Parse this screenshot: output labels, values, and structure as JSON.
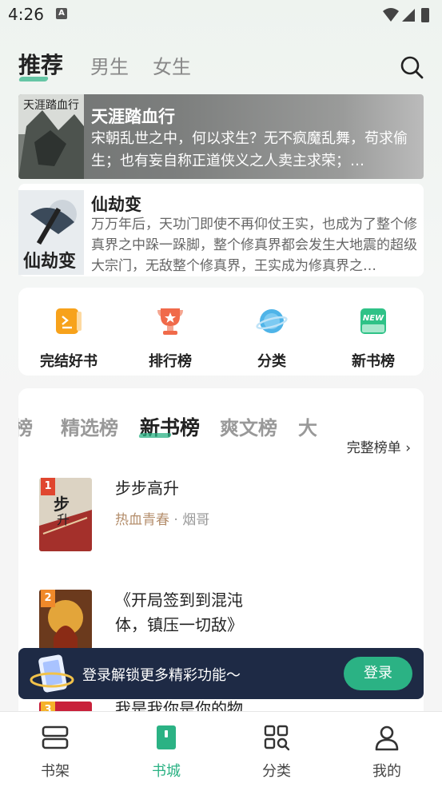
{
  "status_bar": {
    "time": "4:26",
    "notification_icon": "A"
  },
  "top_nav": {
    "tabs": [
      "推荐",
      "男生",
      "女生"
    ],
    "search_icon": "search-icon"
  },
  "featured_books": [
    {
      "title": "天涯踏血行",
      "description": "宋朝乱世之中，何以求生？无不疯魔乱舞，苟求偷生；也有妄自称正道侠义之人卖主求荣；…"
    },
    {
      "title": "仙劫变",
      "description": "万万年后，天功门即使不再仰仗王实，也成为了整个修真界之中跺一跺脚，整个修真界都会发生大地震的超级大宗门，无敌整个修真界，王实成为修真界之…"
    }
  ],
  "quick_entries": [
    {
      "label": "完结好书",
      "icon": "finished-books-icon"
    },
    {
      "label": "排行榜",
      "icon": "trophy-icon"
    },
    {
      "label": "分类",
      "icon": "category-planet-icon"
    },
    {
      "label": "新书榜",
      "icon": "new-badge-icon"
    }
  ],
  "ranking": {
    "tabs": [
      "榜",
      "精选榜",
      "新书榜",
      "爽文榜",
      "大"
    ],
    "active_tab": "新书榜",
    "full_list_label": "完整榜单 ›",
    "items": [
      {
        "rank": "1",
        "title": "步步高升",
        "genre": "热血青春",
        "author": "烟哥"
      },
      {
        "rank": "2",
        "title": "《开局签到到混沌体，镇压一切敌》",
        "genre": "",
        "author": ""
      },
      {
        "rank": "3",
        "title": "我是我你是你的物",
        "genre": "",
        "author": ""
      }
    ]
  },
  "login_banner": {
    "message": "登录解锁更多精彩功能～",
    "button": "登录"
  },
  "bottom_nav": [
    {
      "label": "书架",
      "icon": "bookshelf-icon"
    },
    {
      "label": "书城",
      "icon": "bookstore-icon"
    },
    {
      "label": "分类",
      "icon": "category-grid-icon"
    },
    {
      "label": "我的",
      "icon": "profile-icon"
    }
  ],
  "colors": {
    "accent": "#2bb284",
    "banner": "#1e2a45",
    "genre": "#b48e6c",
    "rank_badge": "#e0462f"
  }
}
